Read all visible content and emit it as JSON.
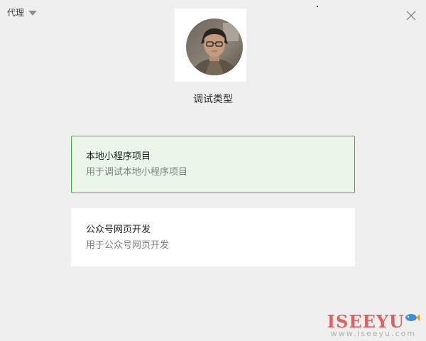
{
  "header": {
    "proxy_label": "代理",
    "close_icon": "close-icon"
  },
  "avatar": {
    "icon": "user-avatar"
  },
  "dialog": {
    "title": "调试类型"
  },
  "options": [
    {
      "title": "本地小程序项目",
      "description": "用于调试本地小程序项目",
      "selected": true
    },
    {
      "title": "公众号网页开发",
      "description": "用于公众号网页开发",
      "selected": false
    }
  ],
  "watermark": {
    "brand": "ISEEYU",
    "site": "www.iseeyu.com"
  },
  "colors": {
    "background": "#efefef",
    "selected_border": "#39b13b",
    "selected_background": "#e9f6e9",
    "card_background": "#ffffff",
    "watermark": "#d9534f"
  }
}
